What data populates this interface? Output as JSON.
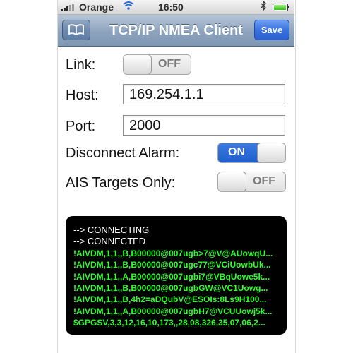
{
  "status_bar": {
    "carrier": "Orange",
    "time": "16:50",
    "wifi_icon": "wifi-icon",
    "bluetooth_icon": "bluetooth-icon",
    "battery_level": 0.95
  },
  "nav": {
    "title": "TCP/IP NMEA Client",
    "left_button_icon": "book-icon",
    "save_label": "Save"
  },
  "form": {
    "link": {
      "label": "Link:",
      "state": "OFF"
    },
    "host": {
      "label": "Host:",
      "value": "169.254.1.1"
    },
    "port": {
      "label": "Port:",
      "value": "2000"
    },
    "disconnect_alarm": {
      "label": "Disconnect Alarm:",
      "state": "ON"
    },
    "ais_targets_only": {
      "label": "AIS Targets Only:",
      "state": "OFF"
    }
  },
  "console": {
    "lines": [
      "--> CONNECTING",
      "--> CONNECTED",
      "!AIVDM,1,1,,B,B00000@007ugb>7@V@AUowqU...",
      "!AIVDM,1,1,,B,B00000@007ugc77@VCiUowbUk...",
      "!AIVDM,1,1,,A,B00000@007ugbi7@VBqUowe5k...",
      "!AIVDM,1,1,,B,B00000@007ugbGW@VC1Uowg...",
      "!AIVDM,1,1,,B,4h2=aDQubV@ESOIs:8Ls9H100...",
      "!AIVDM,1,1,,A,B00000@007ugbH7@VCUUowj5k...",
      "$GPGSV,3,3,12,16,10,173,,28,08,326,35,07,06,2..."
    ]
  },
  "colors": {
    "nav_bar": "#8da3bd",
    "save_button": "#3a73de",
    "toggle_on": "#1f5fcd",
    "console_bg": "#000000",
    "console_data_text": "#2aff2a"
  }
}
